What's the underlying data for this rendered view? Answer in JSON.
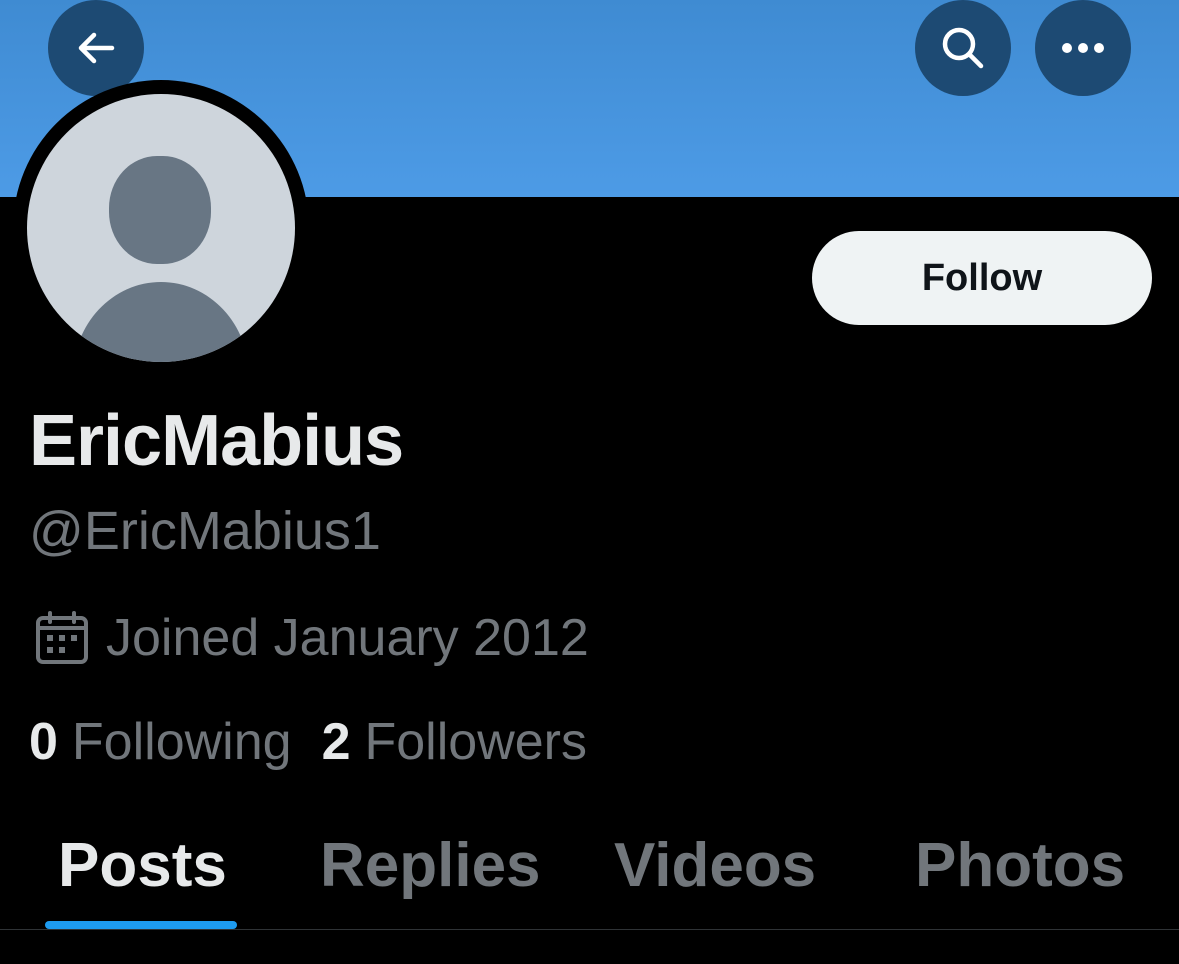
{
  "header": {
    "back_icon": "arrow-left-icon",
    "search_icon": "search-icon",
    "more_icon": "more-horizontal-icon",
    "banner_color": "#4a97e0"
  },
  "profile": {
    "avatar_icon": "default-avatar-icon",
    "follow_label": "Follow",
    "display_name": "EricMabius",
    "handle": "@EricMabius1",
    "joined_icon": "calendar-icon",
    "joined_text": "Joined January 2012",
    "following_count": "0",
    "following_label": "Following",
    "followers_count": "2",
    "followers_label": "Followers"
  },
  "tabs": [
    {
      "label": "Posts",
      "active": true
    },
    {
      "label": "Replies",
      "active": false
    },
    {
      "label": "Videos",
      "active": false
    },
    {
      "label": "Photos",
      "active": false
    }
  ],
  "colors": {
    "accent": "#1d9bf0",
    "background": "#000000",
    "primary_text": "#e7e9ea",
    "secondary_text": "#71767b"
  }
}
